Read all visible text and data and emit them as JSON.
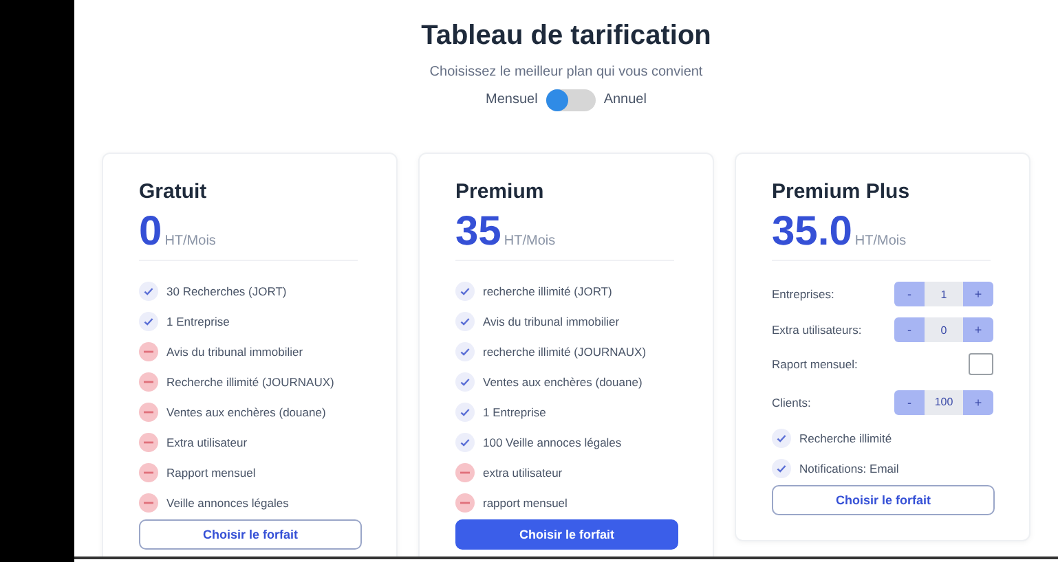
{
  "header": {
    "title": "Tableau de tarification",
    "subtitle": "Choisissez le meilleur plan qui vous convient"
  },
  "billing_toggle": {
    "left_label": "Mensuel",
    "right_label": "Annuel",
    "on": false
  },
  "plans": [
    {
      "name": "Gratuit",
      "price": "0",
      "unit": "HT/Mois",
      "featured": false,
      "button": "Choisir le forfait",
      "items": [
        {
          "kind": "included",
          "label": "30 Recherches (JORT)"
        },
        {
          "kind": "included",
          "label": "1 Entreprise"
        },
        {
          "kind": "excluded",
          "label": "Avis du tribunal immobilier"
        },
        {
          "kind": "excluded",
          "label": "Recherche illimité (JOURNAUX)"
        },
        {
          "kind": "excluded",
          "label": "Ventes aux enchères (douane)"
        },
        {
          "kind": "excluded",
          "label": "Extra utilisateur"
        },
        {
          "kind": "excluded",
          "label": "Rapport mensuel"
        },
        {
          "kind": "excluded",
          "label": "Veille annonces légales"
        }
      ]
    },
    {
      "name": "Premium",
      "price": "35",
      "unit": "HT/Mois",
      "featured": true,
      "button": "Choisir le forfait",
      "items": [
        {
          "kind": "included",
          "label": "recherche illimité (JORT)"
        },
        {
          "kind": "included",
          "label": "Avis du tribunal immobilier"
        },
        {
          "kind": "included",
          "label": "recherche illimité (JOURNAUX)"
        },
        {
          "kind": "included",
          "label": "Ventes aux enchères (douane)"
        },
        {
          "kind": "included",
          "label": "1 Entreprise"
        },
        {
          "kind": "included",
          "label": "100 Veille annoces légales"
        },
        {
          "kind": "excluded",
          "label": "extra utilisateur"
        },
        {
          "kind": "excluded",
          "label": "rapport mensuel"
        }
      ]
    },
    {
      "name": "Premium Plus",
      "price": "35.0",
      "unit": "HT/Mois",
      "featured": false,
      "button": "Choisir le forfait",
      "items": [
        {
          "kind": "stepper",
          "label": "Entreprises:",
          "minus": "-",
          "value": "1",
          "plus": "+"
        },
        {
          "kind": "stepper",
          "label": "Extra utilisateurs:",
          "minus": "-",
          "value": "0",
          "plus": "+"
        },
        {
          "kind": "checkbox",
          "label": "Raport mensuel:",
          "checked": false
        },
        {
          "kind": "stepper",
          "label": "Clients:",
          "minus": "-",
          "value": "100",
          "plus": "+"
        },
        {
          "kind": "included",
          "label": "Recherche illimité"
        },
        {
          "kind": "included",
          "label": "Notifications: Email"
        }
      ]
    }
  ]
}
